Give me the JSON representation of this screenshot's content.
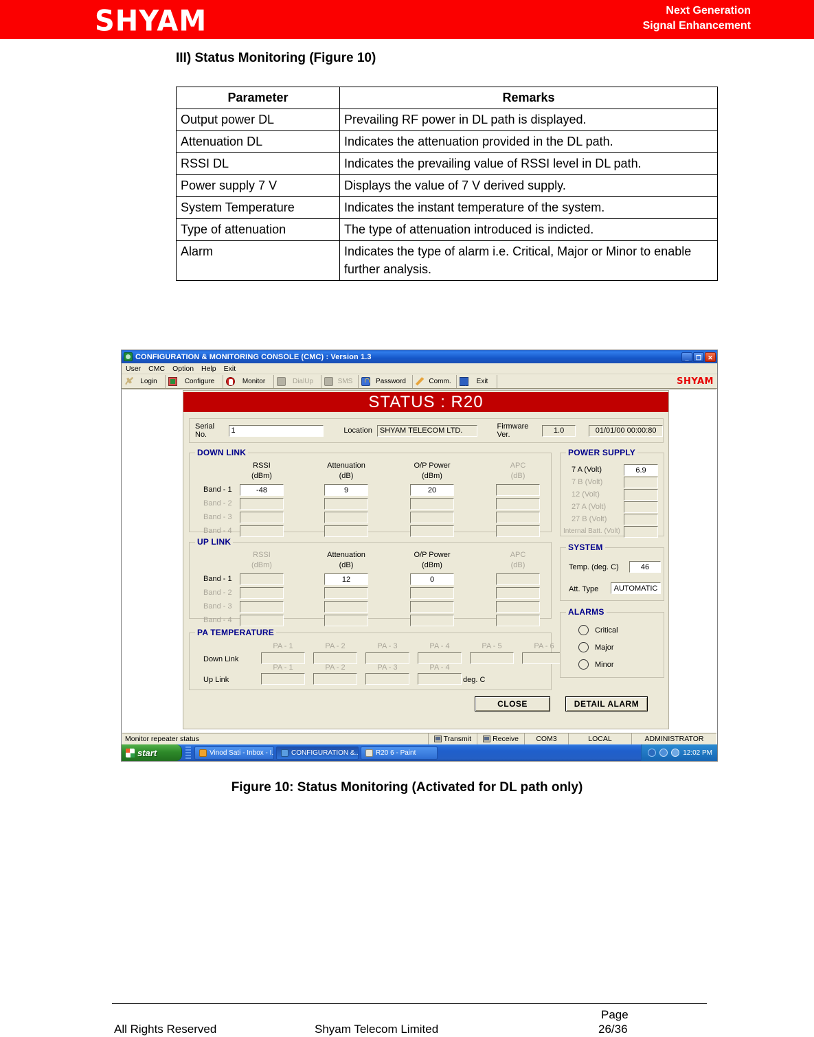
{
  "page_header": {
    "logo": "SHYAM",
    "tagline_line1": "Next Generation",
    "tagline_line2": "Signal Enhancement",
    "band_color": "#fb0000"
  },
  "doc": {
    "heading": "III) Status Monitoring (Figure 10)",
    "figure_caption": "Figure 10: Status Monitoring (Activated for DL path only)"
  },
  "param_table": {
    "headers": [
      "Parameter",
      "Remarks"
    ],
    "rows": [
      {
        "parameter": "Output power DL",
        "remarks": "Prevailing RF power in DL path is displayed."
      },
      {
        "parameter": "Attenuation DL",
        "remarks": "Indicates the attenuation provided in the DL path."
      },
      {
        "parameter": "RSSI DL",
        "remarks": "Indicates the prevailing value of RSSI level in DL path."
      },
      {
        "parameter": "Power supply 7 V",
        "remarks": "Displays the value of 7 V derived supply."
      },
      {
        "parameter": "System Temperature",
        "remarks": "Indicates the instant temperature of the system."
      },
      {
        "parameter": "Type of attenuation",
        "remarks": "The type of attenuation introduced is indicted."
      },
      {
        "parameter": "Alarm",
        "remarks": "Indicates the type of alarm i.e. Critical, Major or Minor to enable further analysis."
      }
    ]
  },
  "app": {
    "title": "CONFIGURATION & MONITORING CONSOLE (CMC)  :  Version 1.3",
    "window_buttons": {
      "minimize": "_",
      "restore": "❐",
      "close": "✕"
    },
    "menu": [
      "User",
      "CMC",
      "Option",
      "Help",
      "Exit"
    ],
    "toolbar": [
      {
        "label": "Login",
        "icon": "wrench-icon",
        "disabled": false
      },
      {
        "label": "Configure",
        "icon": "configure-icon",
        "disabled": false
      },
      {
        "label": "Monitor",
        "icon": "monitor-icon",
        "disabled": false
      },
      {
        "label": "DialUp",
        "icon": "dialup-icon",
        "disabled": true
      },
      {
        "label": "SMS",
        "icon": "sms-icon",
        "disabled": true
      },
      {
        "label": "Password",
        "icon": "lock-icon",
        "disabled": false
      },
      {
        "label": "Comm.",
        "icon": "pen-icon",
        "disabled": false
      },
      {
        "label": "Exit",
        "icon": "exit-door-icon",
        "disabled": false
      }
    ],
    "toolbar_logo": "SHYAM",
    "status_bar": {
      "message": "Monitor repeater status",
      "transmit": "Transmit",
      "receive": "Receive",
      "port": "COM3",
      "mode": "LOCAL",
      "user": "ADMINISTRATOR"
    },
    "taskbar": {
      "start": "start",
      "items": [
        {
          "label": "Vinod Sati - Inbox - I...",
          "icon": "mail-icon",
          "active": false
        },
        {
          "label": "CONFIGURATION &...",
          "icon": "cmc-icon",
          "active": true
        },
        {
          "label": "R20 6 - Paint",
          "icon": "paint-icon",
          "active": false
        }
      ],
      "clock": "12:02 PM"
    }
  },
  "dialog": {
    "banner": "STATUS : R20",
    "header": {
      "serial_no_label": "Serial No.",
      "serial_no_value": "1",
      "location_label": "Location",
      "location_value": "SHYAM TELECOM LTD.",
      "firmware_label": "Firmware Ver.",
      "firmware_value": "1.0",
      "datetime_value": "01/01/00 00:00:80"
    },
    "down_link": {
      "title": "DOWN LINK",
      "columns": [
        {
          "name": "RSSI",
          "unit": "(dBm)",
          "dim": false
        },
        {
          "name": "Attenuation",
          "unit": "(dB)",
          "dim": false
        },
        {
          "name": "O/P Power",
          "unit": "(dBm)",
          "dim": false
        },
        {
          "name": "APC",
          "unit": "(dB)",
          "dim": true
        }
      ],
      "rows": [
        {
          "label": "Band - 1",
          "dim": false,
          "values": [
            "-48",
            "9",
            "20",
            ""
          ],
          "active": [
            true,
            true,
            true,
            false
          ]
        },
        {
          "label": "Band - 2",
          "dim": true,
          "values": [
            "",
            "",
            "",
            ""
          ],
          "active": [
            false,
            false,
            false,
            false
          ]
        },
        {
          "label": "Band - 3",
          "dim": true,
          "values": [
            "",
            "",
            "",
            ""
          ],
          "active": [
            false,
            false,
            false,
            false
          ]
        },
        {
          "label": "Band - 4",
          "dim": true,
          "values": [
            "",
            "",
            "",
            ""
          ],
          "active": [
            false,
            false,
            false,
            false
          ]
        }
      ]
    },
    "up_link": {
      "title": "UP LINK",
      "columns": [
        {
          "name": "RSSI",
          "unit": "(dBm)",
          "dim": true
        },
        {
          "name": "Attenuation",
          "unit": "(dB)",
          "dim": false
        },
        {
          "name": "O/P Power",
          "unit": "(dBm)",
          "dim": false
        },
        {
          "name": "APC",
          "unit": "(dB)",
          "dim": true
        }
      ],
      "rows": [
        {
          "label": "Band - 1",
          "dim": false,
          "values": [
            "",
            "12",
            "0",
            ""
          ],
          "active": [
            false,
            true,
            true,
            false
          ]
        },
        {
          "label": "Band - 2",
          "dim": true,
          "values": [
            "",
            "",
            "",
            ""
          ],
          "active": [
            false,
            false,
            false,
            false
          ]
        },
        {
          "label": "Band - 3",
          "dim": true,
          "values": [
            "",
            "",
            "",
            ""
          ],
          "active": [
            false,
            false,
            false,
            false
          ]
        },
        {
          "label": "Band - 4",
          "dim": true,
          "values": [
            "",
            "",
            "",
            ""
          ],
          "active": [
            false,
            false,
            false,
            false
          ]
        }
      ]
    },
    "pa_temperature": {
      "title": "PA TEMPERATURE",
      "unit": "deg. C",
      "down_link_label": "Down Link",
      "up_link_label": "Up Link",
      "down_link_columns": [
        "PA - 1",
        "PA - 2",
        "PA - 3",
        "PA - 4",
        "PA - 5",
        "PA - 6"
      ],
      "up_link_columns": [
        "PA - 1",
        "PA - 2",
        "PA - 3",
        "PA - 4"
      ],
      "down_link_values": [
        "",
        "",
        "",
        "",
        "",
        ""
      ],
      "up_link_values": [
        "",
        "",
        "",
        ""
      ]
    },
    "power_supply": {
      "title": "POWER SUPPLY",
      "rows": [
        {
          "label": "7 A (Volt)",
          "value": "6.9",
          "dim": false,
          "active": true
        },
        {
          "label": "7 B (Volt)",
          "value": "",
          "dim": true,
          "active": false
        },
        {
          "label": "12 (Volt)",
          "value": "",
          "dim": true,
          "active": false
        },
        {
          "label": "27 A  (Volt)",
          "value": "",
          "dim": true,
          "active": false
        },
        {
          "label": "27 B  (Volt)",
          "value": "",
          "dim": true,
          "active": false
        },
        {
          "label": "Internal Batt. (Volt)",
          "value": "",
          "dim": true,
          "active": false
        }
      ]
    },
    "system": {
      "title": "SYSTEM",
      "temp_label": "Temp. (deg. C)",
      "temp_value": "46",
      "att_type_label": "Att. Type",
      "att_type_value": "AUTOMATIC"
    },
    "alarms": {
      "title": "ALARMS",
      "items": [
        "Critical",
        "Major",
        "Minor"
      ]
    },
    "buttons": {
      "close": "CLOSE",
      "detail_alarm": "DETAIL ALARM"
    }
  },
  "footer": {
    "left": "All Rights Reserved",
    "middle": "Shyam Telecom Limited",
    "page_word": "Page",
    "page_number": "26/36"
  }
}
